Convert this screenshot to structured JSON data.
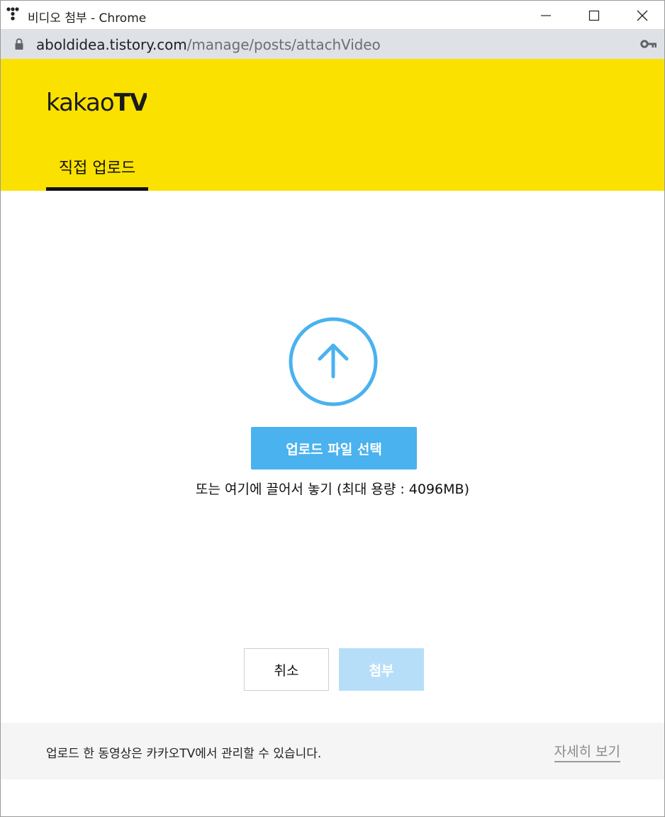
{
  "window": {
    "title": "비디오 첨부 - Chrome"
  },
  "address_bar": {
    "host": "aboldidea.tistory.com",
    "path": "/manage/posts/attachVideo"
  },
  "header": {
    "logo_light": "kakao",
    "logo_bold": "TV",
    "tab_label": "직접 업로드",
    "brand_color": "#fae100"
  },
  "upload": {
    "icon": "upload-arrow-icon",
    "button_label": "업로드 파일 선택",
    "hint": "또는 여기에 끌어서 놓기 (최대 용량 : 4096MB)",
    "accent_color": "#4ab2ef"
  },
  "actions": {
    "cancel_label": "취소",
    "attach_label": "첨부"
  },
  "footer": {
    "info": "업로드 한 동영상은 카카오TV에서 관리할 수 있습니다.",
    "more_label": "자세히 보기"
  }
}
